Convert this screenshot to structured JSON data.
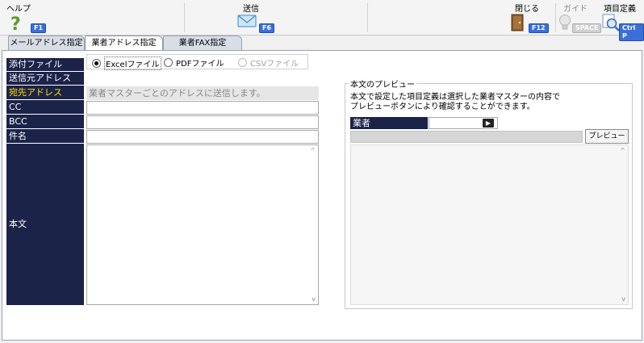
{
  "toolbar": {
    "help": {
      "label": "ヘルプ",
      "key": "F1"
    },
    "send": {
      "label": "送信",
      "key": "F6"
    },
    "close": {
      "label": "閉じる",
      "key": "F12"
    },
    "guide": {
      "label": "ガイド",
      "key": "SPACE"
    },
    "item_def": {
      "label": "項目定義",
      "key": "Ctrl P"
    }
  },
  "tabs": [
    {
      "label": "メールアドレス指定"
    },
    {
      "label": "業者アドレス指定"
    },
    {
      "label": "業者FAX指定"
    }
  ],
  "form": {
    "attach_label": "添付ファイル",
    "attach_options": [
      "Excelファイル",
      "PDFファイル",
      "CSVファイル"
    ],
    "selected_attach": "Excelファイル",
    "sender_label": "送信元アドレス",
    "dest_label": "宛先アドレス",
    "dest_hint": "業者マスターごとのアドレスに送信します。",
    "cc_label": "CC",
    "bcc_label": "BCC",
    "subject_label": "件名",
    "body_label": "本文"
  },
  "preview": {
    "title": "本文のプレビュー",
    "desc_line1": "本文で設定した項目定義は選択した業者マスターの内容で",
    "desc_line2": "プレビューボタンにより確認することができます。",
    "vendor_label": "業者",
    "vendor_value": "",
    "preview_button": "プレビュー"
  },
  "colors": {
    "label_bg": "#1c2349",
    "label_text": "#ffffff",
    "label_highlight": "#ffe000",
    "accent_key": "#3b6fd8"
  }
}
